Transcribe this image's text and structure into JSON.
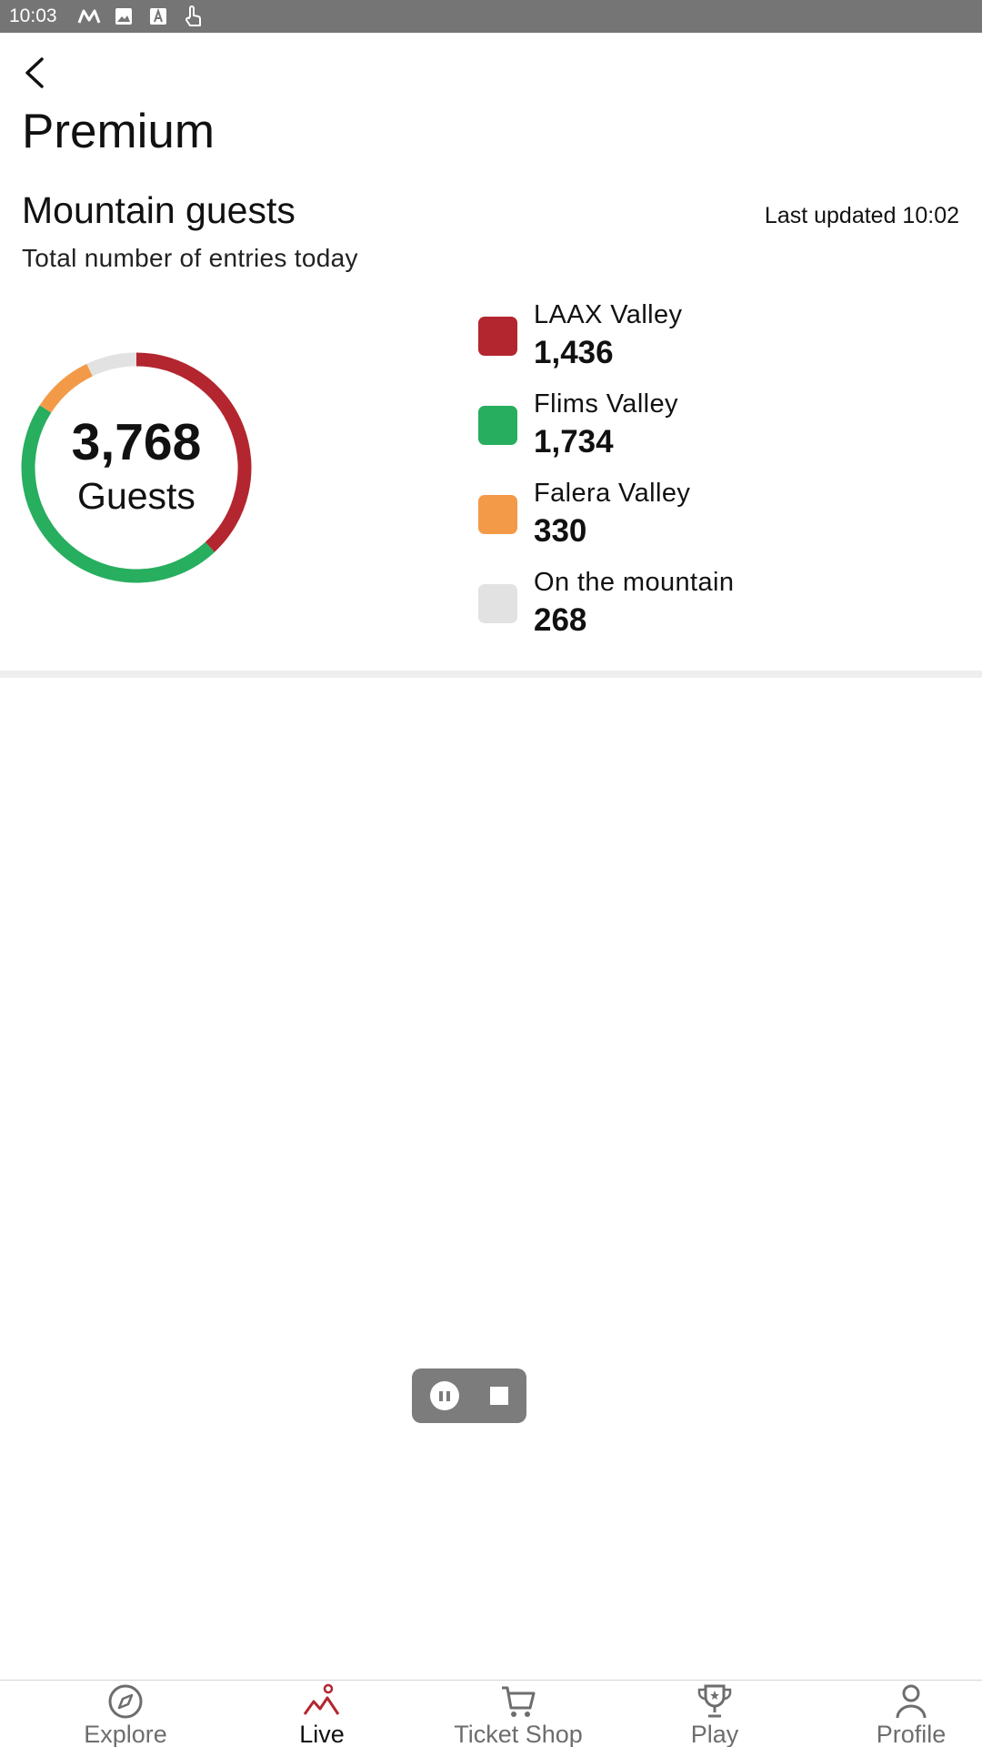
{
  "status_bar": {
    "time": "10:03"
  },
  "header": {
    "title": "Premium"
  },
  "guests_card": {
    "title": "Mountain guests",
    "subtitle": "Total number of entries today",
    "last_updated": "Last updated 10:02",
    "total": "3,768",
    "total_unit": "Guests"
  },
  "chart_data": {
    "type": "pie",
    "total": 3768,
    "slices": [
      {
        "label": "LAAX Valley",
        "value": 1436,
        "display": "1,436",
        "color": "#b3262f"
      },
      {
        "label": "Flims Valley",
        "value": 1734,
        "display": "1,734",
        "color": "#27ae5e"
      },
      {
        "label": "Falera Valley",
        "value": 330,
        "display": "330",
        "color": "#f39a48"
      },
      {
        "label": "On the mountain",
        "value": 268,
        "display": "268",
        "color": "#e2e2e2"
      }
    ]
  },
  "bottom_nav": {
    "items": [
      {
        "label": "Explore",
        "icon": "compass-icon"
      },
      {
        "label": "Live",
        "icon": "mountain-live-icon",
        "active": true
      },
      {
        "label": "Ticket Shop",
        "icon": "cart-icon"
      },
      {
        "label": "Play",
        "icon": "trophy-icon"
      },
      {
        "label": "Profile",
        "icon": "person-icon"
      }
    ]
  },
  "colors": {
    "accent": "#b3262f",
    "inactive": "#6d6d6d"
  }
}
